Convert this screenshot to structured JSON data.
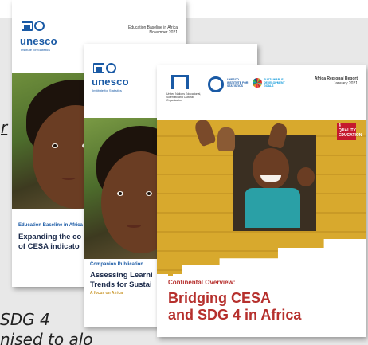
{
  "partial_text": {
    "left_word": "r",
    "bottom_line_1": "SDG 4",
    "bottom_line_2": "nised to alo"
  },
  "cover1": {
    "header_line_1": "Education Baseline in Africa",
    "header_line_2": "November 2021",
    "brand": "unesco",
    "brand_sub": "Institute for Statistics",
    "kicker": "Education Baseline in Africa",
    "title_line_1": "Expanding the co",
    "title_line_2": "of CESA indicato"
  },
  "cover2": {
    "brand": "unesco",
    "brand_sub": "Institute for Statistics",
    "kicker": "Companion Publication",
    "title_line_1": "Assessing Learni",
    "title_line_2": "Trends for Sustai",
    "subtitle": "A focus on Africa"
  },
  "cover3": {
    "report_label": "Africa Regional Report",
    "report_date": "January 2021",
    "org_name": "United Nations Educational, Scientific and Cultural Organization",
    "partner_text": "UNESCO INSTITUTE FOR STATISTICS",
    "sdg_text": "SUSTAINABLE DEVELOPMENT GOALS",
    "sdg_badge": "4 QUALITY EDUCATION",
    "kicker": "Continental Overview:",
    "title_line_1": "Bridging CESA",
    "title_line_2": "and SDG 4 in Africa"
  },
  "colors": {
    "unesco_blue": "#1a5aa5",
    "title_red": "#b6302d",
    "gold": "#d8a92d",
    "sdg_red": "#c5192d"
  }
}
